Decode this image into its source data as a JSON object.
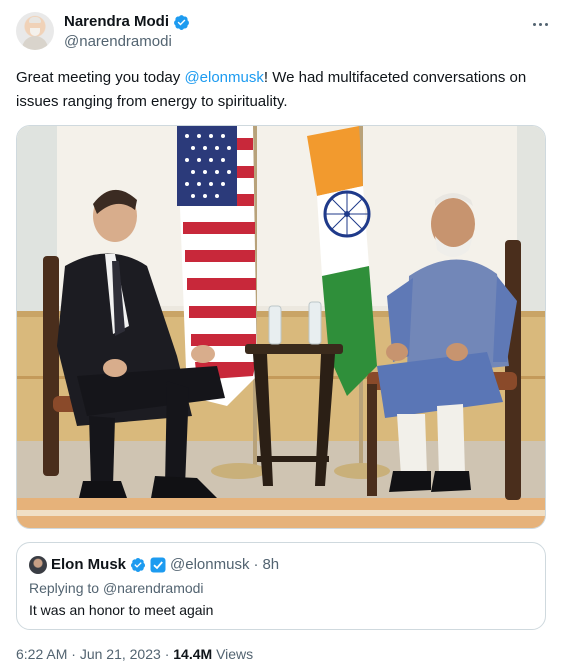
{
  "author": {
    "name": "Narendra Modi",
    "handle": "@narendramodi",
    "verified_icon": "verified-badge-icon"
  },
  "more_icon": "more-dots-icon",
  "tweet": {
    "text_before": "Great meeting you today ",
    "mention": "@elonmusk",
    "text_after": "! We had multifaceted conversations on issues ranging from energy to spirituality."
  },
  "photo": {
    "subject": "photo of two men seated in chairs beside US and Indian flags",
    "accent": "#1d9bf0"
  },
  "quote": {
    "name": "Elon Musk",
    "handle": "@elonmusk",
    "separator": "·",
    "time": "8h",
    "reply_prefix": "Replying to ",
    "reply_handle": "@narendramodi",
    "text": "It was an honor to meet again"
  },
  "meta": {
    "time": "6:22 AM",
    "separator": "·",
    "date": "Jun 21, 2023",
    "views_count": "14.4M",
    "views_label": "Views"
  },
  "colors": {
    "link": "#1d9bf0",
    "secondary_text": "#536471",
    "border": "#cfd9de",
    "verified_blue": "#1d9bf0"
  }
}
